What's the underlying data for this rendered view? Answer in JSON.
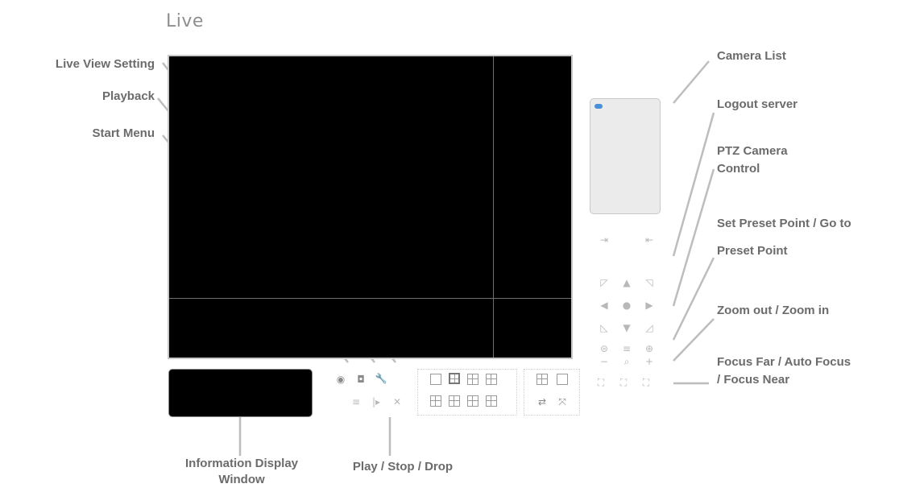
{
  "page": {
    "title": "Live"
  },
  "labels": {
    "live_view_setting": "Live View Setting",
    "playback": "Playback",
    "start_menu": "Start Menu",
    "camera_list": "Camera List",
    "logout_server": "Logout server",
    "ptz_line1": "PTZ Camera",
    "ptz_line2": "Control",
    "set_preset": "Set Preset Point / Go to",
    "preset_point": "Preset Point",
    "zoom": "Zoom out / Zoom in",
    "focus_line1": "Focus Far / Auto Focus",
    "focus_line2": "/ Focus Near",
    "info_line1": "Information Display",
    "info_line2": "Window",
    "play_stop_drop": "Play / Stop / Drop"
  },
  "controls": {
    "start_menu_icon": "◉",
    "playback_icon": "◘",
    "settings_icon": "🔧",
    "play_icon": "≡",
    "stop_icon": "|▸",
    "drop_icon": "✕",
    "logout_left_icon": "⇥",
    "logout_right_icon": "⇤",
    "ptz_up_left": "◸",
    "ptz_up": "▲",
    "ptz_up_right": "◹",
    "ptz_left": "◀",
    "ptz_center": "●",
    "ptz_right": "▶",
    "ptz_down_left": "◺",
    "ptz_down": "▼",
    "ptz_down_right": "◿",
    "preset_set": "⊜",
    "preset_list": "≡",
    "preset_go": "⊕",
    "zoom_out": "−",
    "zoom_mid": "⌕",
    "zoom_in": "+",
    "focus_far": "⛶",
    "focus_auto": "⛶",
    "focus_near": "⛶",
    "swap_icon": "⇄",
    "fullscreen_icon": "⤧"
  },
  "colors": {
    "video_bg": "#000000",
    "leader": "#bdbdbd",
    "label": "#6b6b6b"
  }
}
